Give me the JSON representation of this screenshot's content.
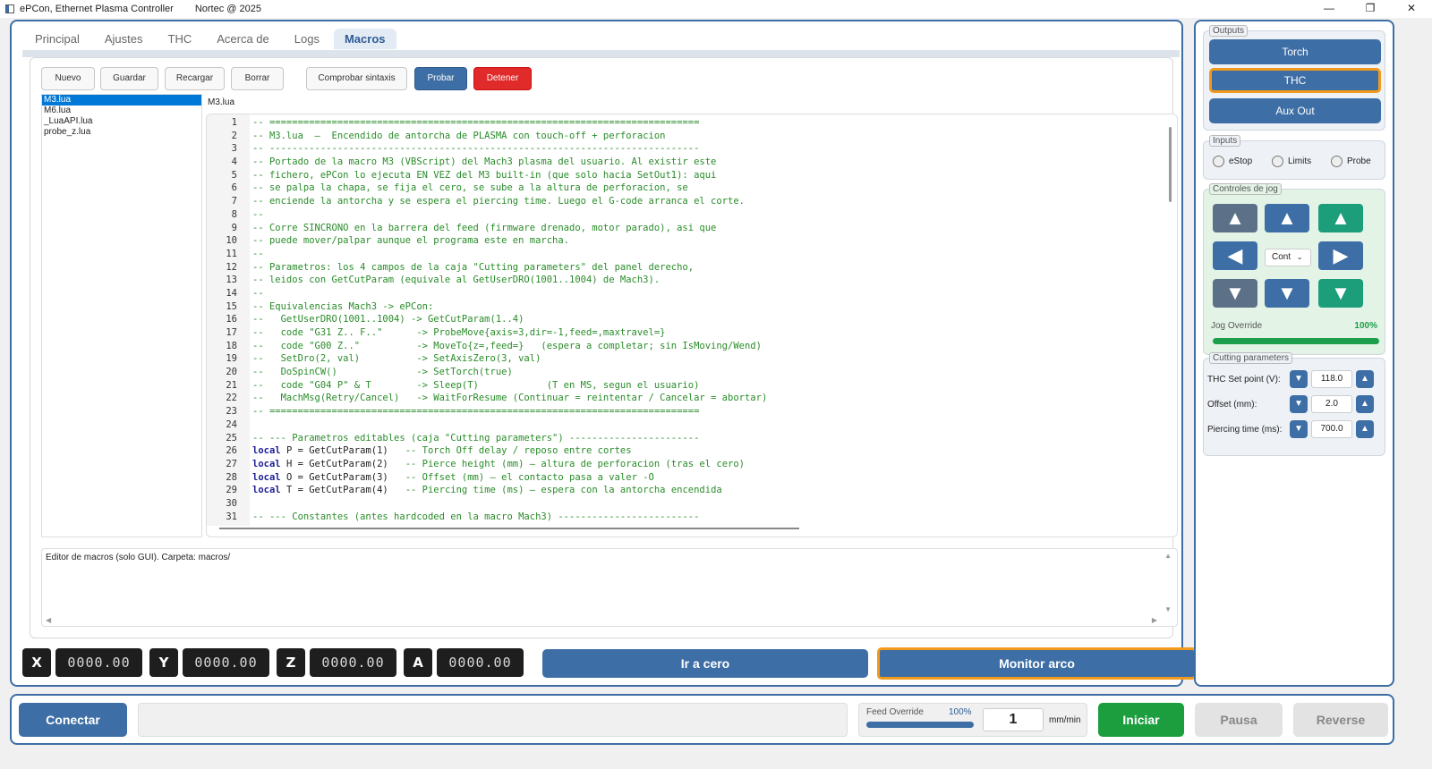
{
  "window": {
    "title": "ePCon, Ethernet Plasma Controller",
    "copyright": "Nortec @ 2025",
    "minimize": "—",
    "maximize": "❐",
    "close": "✕"
  },
  "tabs": [
    "Principal",
    "Ajustes",
    "THC",
    "Acerca de",
    "Logs",
    "Macros"
  ],
  "active_tab": "Macros",
  "toolbar": {
    "nuevo": "Nuevo",
    "guardar": "Guardar",
    "recargar": "Recargar",
    "borrar": "Borrar",
    "comprobar": "Comprobar sintaxis",
    "probar": "Probar",
    "detener": "Detener"
  },
  "files": [
    "M3.lua",
    "M6.lua",
    "_LuaAPI.lua",
    "probe_z.lua"
  ],
  "selected_file": "M3.lua",
  "editor": {
    "filename": "M3.lua",
    "line_numbers": [
      "1",
      "2",
      "3",
      "4",
      "5",
      "6",
      "7",
      "8",
      "9",
      "10",
      "11",
      "12",
      "13",
      "14",
      "15",
      "16",
      "17",
      "18",
      "19",
      "20",
      "21",
      "22",
      "23",
      "24",
      "25",
      "26",
      "27",
      "28",
      "29",
      "30",
      "31"
    ],
    "lines": [
      "-- ============================================================================",
      "-- M3.lua  —  Encendido de antorcha de PLASMA con touch-off + perforacion",
      "-- ----------------------------------------------------------------------------",
      "-- Portado de la macro M3 (VBScript) del Mach3 plasma del usuario. Al existir este",
      "-- fichero, ePCon lo ejecuta EN VEZ del M3 built-in (que solo hacia SetOut1): aqui",
      "-- se palpa la chapa, se fija el cero, se sube a la altura de perforacion, se",
      "-- enciende la antorcha y se espera el piercing time. Luego el G-code arranca el corte.",
      "--",
      "-- Corre SINCRONO en la barrera del feed (firmware drenado, motor parado), asi que",
      "-- puede mover/palpar aunque el programa este en marcha.",
      "--",
      "-- Parametros: los 4 campos de la caja \"Cutting parameters\" del panel derecho,",
      "-- leidos con GetCutParam (equivale al GetUserDRO(1001..1004) de Mach3).",
      "--",
      "-- Equivalencias Mach3 -> ePCon:",
      "--   GetUserDRO(1001..1004) -> GetCutParam(1..4)",
      "--   code \"G31 Z.. F..\"      -> ProbeMove{axis=3,dir=-1,feed=,maxtravel=}",
      "--   code \"G00 Z..\"          -> MoveTo{z=,feed=}   (espera a completar; sin IsMoving/Wend)",
      "--   SetDro(2, val)          -> SetAxisZero(3, val)",
      "--   DoSpinCW()              -> SetTorch(true)",
      "--   code \"G04 P\" & T        -> Sleep(T)            (T en MS, segun el usuario)",
      "--   MachMsg(Retry/Cancel)   -> WaitForResume (Continuar = reintentar / Cancelar = abortar)",
      "-- ============================================================================",
      "",
      "-- --- Parametros editables (caja \"Cutting parameters\") -----------------------",
      "P = GetCutParam(1)   -- Torch Off delay / reposo entre cortes",
      "H = GetCutParam(2)   -- Pierce height (mm) — altura de perforacion (tras el cero)",
      "O = GetCutParam(3)   -- Offset (mm) — el contacto pasa a valer -O",
      "T = GetCutParam(4)   -- Piercing time (ms) — espera con la antorcha encendida",
      "",
      "-- --- Constantes (antes hardcoded en la macro Mach3) -------------------------"
    ],
    "keyword": "local"
  },
  "console": {
    "text": "Editor de macros (solo GUI). Carpeta: macros/"
  },
  "dro": [
    {
      "axis": "X",
      "value": "0000.00"
    },
    {
      "axis": "Y",
      "value": "0000.00"
    },
    {
      "axis": "Z",
      "value": "0000.00"
    },
    {
      "axis": "A",
      "value": "0000.00"
    }
  ],
  "actions": {
    "ir_a_cero": "Ir a cero",
    "monitor_arco": "Monitor arco"
  },
  "outputs": {
    "legend": "Outputs",
    "torch": "Torch",
    "thc": "THC",
    "aux": "Aux Out"
  },
  "inputs": {
    "legend": "Inputs",
    "estop": "eStop",
    "limits": "Limits",
    "probe": "Probe"
  },
  "jog": {
    "legend": "Controles de jog",
    "mode": "Cont",
    "override_label": "Jog Override",
    "override_value": "100%",
    "override_fraction": 1.0
  },
  "cutting": {
    "legend": "Cutting parameters",
    "rows": [
      {
        "label": "THC Set point (V):",
        "value": "118.0"
      },
      {
        "label": "Offset (mm):",
        "value": "2.0"
      },
      {
        "label": "Piercing time (ms):",
        "value": "700.0"
      }
    ]
  },
  "bottom": {
    "conectar": "Conectar",
    "status": "",
    "feed_label": "Feed Override",
    "feed_value": "100%",
    "feed_fraction": 1.0,
    "feed_input": "1",
    "feed_unit": "mm/min",
    "iniciar": "Iniciar",
    "pausa": "Pausa",
    "reverse": "Reverse"
  },
  "colors": {
    "accent": "#3d6ea5",
    "stop": "#e12b2b",
    "start": "#1c9e3f",
    "highlight": "#f29a1c",
    "jog_green": "#1c9e7a",
    "code_comment": "#2a8c2a"
  }
}
